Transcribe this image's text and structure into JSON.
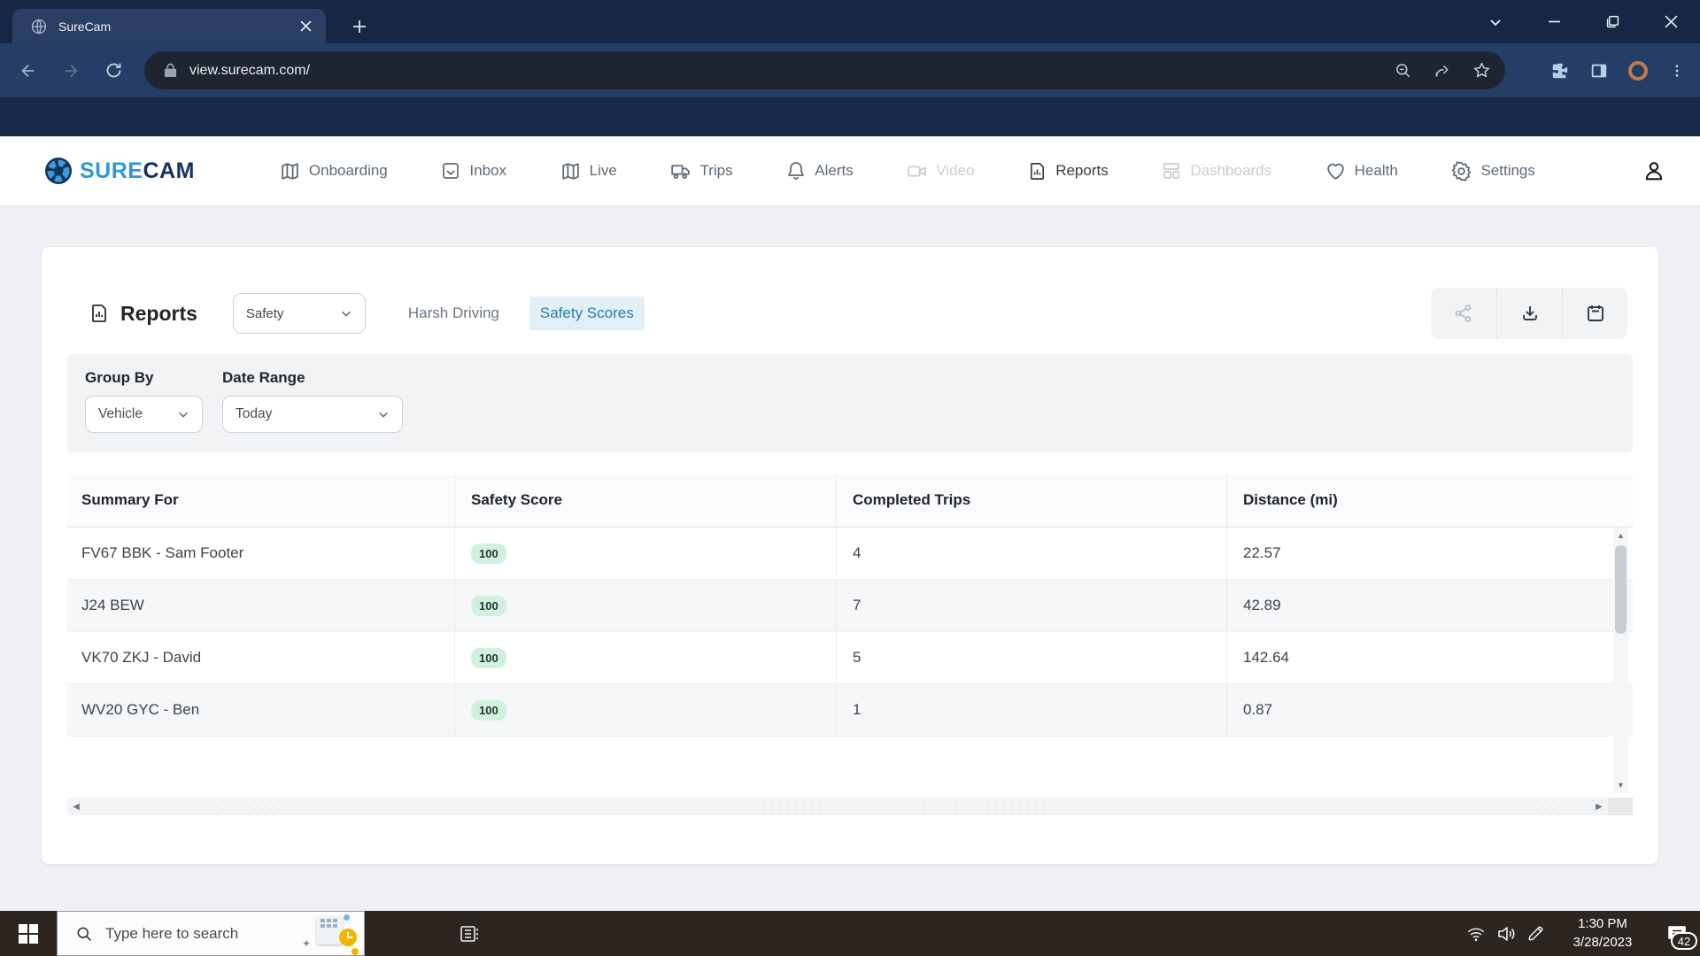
{
  "browser": {
    "tab_title": "SureCam",
    "url": "view.surecam.com/"
  },
  "brand": {
    "sure": "SURE",
    "cam": "CAM"
  },
  "nav": {
    "items": [
      {
        "label": "Onboarding",
        "state": "normal"
      },
      {
        "label": "Inbox",
        "state": "normal"
      },
      {
        "label": "Live",
        "state": "normal"
      },
      {
        "label": "Trips",
        "state": "normal"
      },
      {
        "label": "Alerts",
        "state": "normal"
      },
      {
        "label": "Video",
        "state": "disabled"
      },
      {
        "label": "Reports",
        "state": "active"
      },
      {
        "label": "Dashboards",
        "state": "disabled"
      },
      {
        "label": "Health",
        "state": "normal"
      },
      {
        "label": "Settings",
        "state": "normal"
      }
    ]
  },
  "report_header": {
    "title": "Reports",
    "report_type_value": "Safety",
    "tab_harsh_driving": "Harsh Driving",
    "tab_safety_scores": "Safety Scores"
  },
  "filters": {
    "group_by_label": "Group By",
    "group_by_value": "Vehicle",
    "date_range_label": "Date Range",
    "date_range_value": "Today"
  },
  "table": {
    "columns": [
      "Summary For",
      "Safety Score",
      "Completed Trips",
      "Distance (mi)"
    ],
    "rows": [
      {
        "summary_for": "FV67 BBK - Sam Footer",
        "safety_score": "100",
        "completed_trips": "4",
        "distance_mi": "22.57"
      },
      {
        "summary_for": "J24 BEW",
        "safety_score": "100",
        "completed_trips": "7",
        "distance_mi": "42.89"
      },
      {
        "summary_for": "VK70 ZKJ - David",
        "safety_score": "100",
        "completed_trips": "5",
        "distance_mi": "142.64"
      },
      {
        "summary_for": "WV20 GYC - Ben",
        "safety_score": "100",
        "completed_trips": "1",
        "distance_mi": "0.87"
      }
    ]
  },
  "taskbar": {
    "search_placeholder": "Type here to search",
    "clock_time": "1:30 PM",
    "clock_date": "3/28/2023",
    "notification_count": "42"
  },
  "colors": {
    "brand_blue": "#2E9AD2",
    "brand_navy": "#16325F",
    "active_tab_text": "#2E7CAB",
    "active_tab_bg": "#E1F0F7",
    "badge_bg": "#D1F1DE",
    "browser_frame": "#152744",
    "browser_toolbar": "#243E66",
    "page_header_navy": "#172A4A",
    "taskbar_bg": "#2D2520"
  }
}
